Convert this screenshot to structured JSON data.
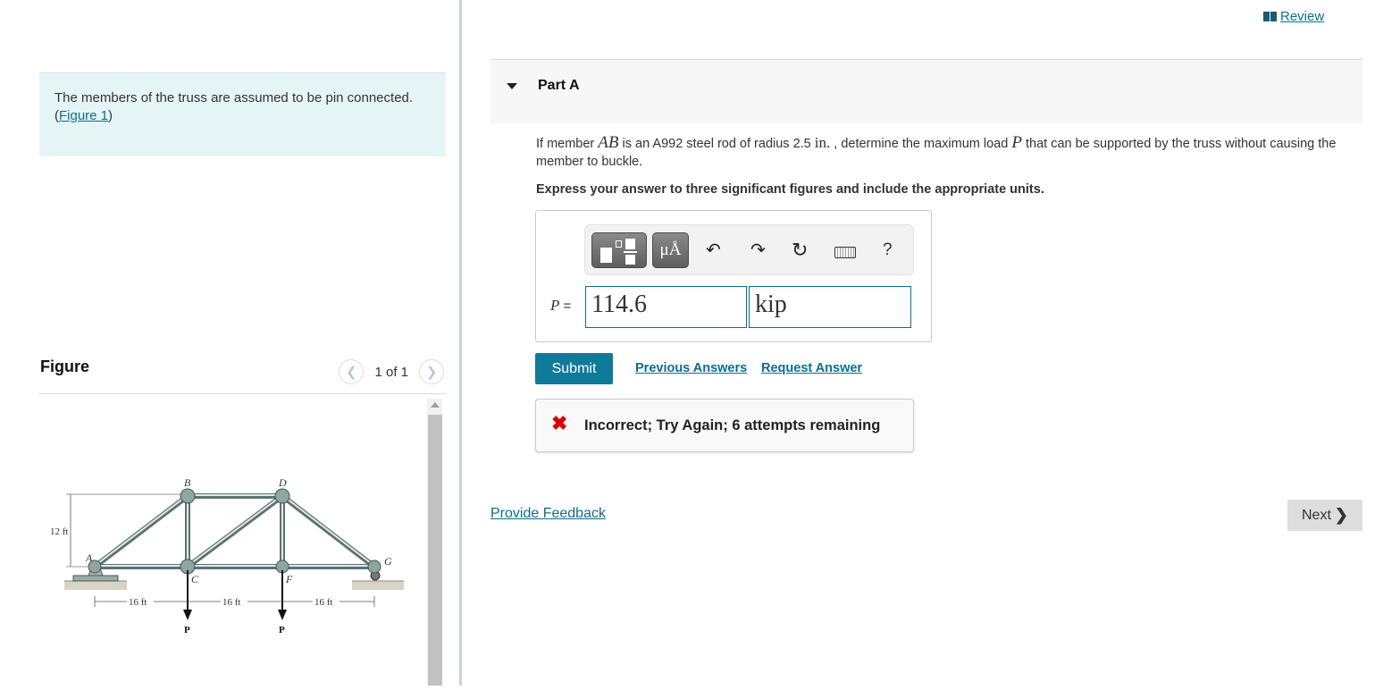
{
  "review": {
    "label": "Review",
    "icon": "book-icon"
  },
  "intro": {
    "text": "The members of the truss are assumed to be pin connected.",
    "figure_link": "Figure 1",
    "open_paren": "(",
    "close_paren": ")"
  },
  "figure": {
    "title": "Figure",
    "pager": {
      "text": "1 of 1",
      "prev_icon": "chevron-left-icon",
      "next_icon": "chevron-right-icon"
    },
    "diagram": {
      "joints": [
        "A",
        "B",
        "C",
        "D",
        "F",
        "G"
      ],
      "height_label": "12 ft",
      "span_labels": [
        "16 ft",
        "16 ft",
        "16 ft"
      ],
      "load_labels": [
        "P",
        "P"
      ]
    }
  },
  "part": {
    "title": "Part A",
    "question": {
      "pre": "If member ",
      "member": "AB",
      "mid1": " is an A992 steel rod of radius 2.5 ",
      "unit": "in.",
      "mid2": " , determine the maximum load ",
      "var": "P",
      "post": " that can be supported by the truss without causing the member to buckle."
    },
    "instruction": "Express your answer to three significant figures and include the appropriate units.",
    "toolbar": {
      "templates": "templates-icon",
      "units": "μÅ",
      "undo": "↶",
      "redo": "↷",
      "reset": "↻",
      "keyboard": "keyboard-icon",
      "help": "?"
    },
    "answer": {
      "variable": "P",
      "equals": " =",
      "value": "114.6",
      "unit": "kip"
    },
    "submit_label": "Submit",
    "previous_answers_label": "Previous Answers",
    "request_answer_label": "Request Answer",
    "feedback": {
      "icon": "✖",
      "text": "Incorrect; Try Again; 6 attempts remaining",
      "color": "#d60000"
    }
  },
  "footer": {
    "provide_feedback_label": "Provide Feedback",
    "next_label": "Next",
    "next_icon": "❯"
  },
  "colors": {
    "accent": "#0f7a9a",
    "link": "#0f6d8c",
    "intro_bg": "#e5f5f6",
    "divider": "#c4d3e2"
  }
}
